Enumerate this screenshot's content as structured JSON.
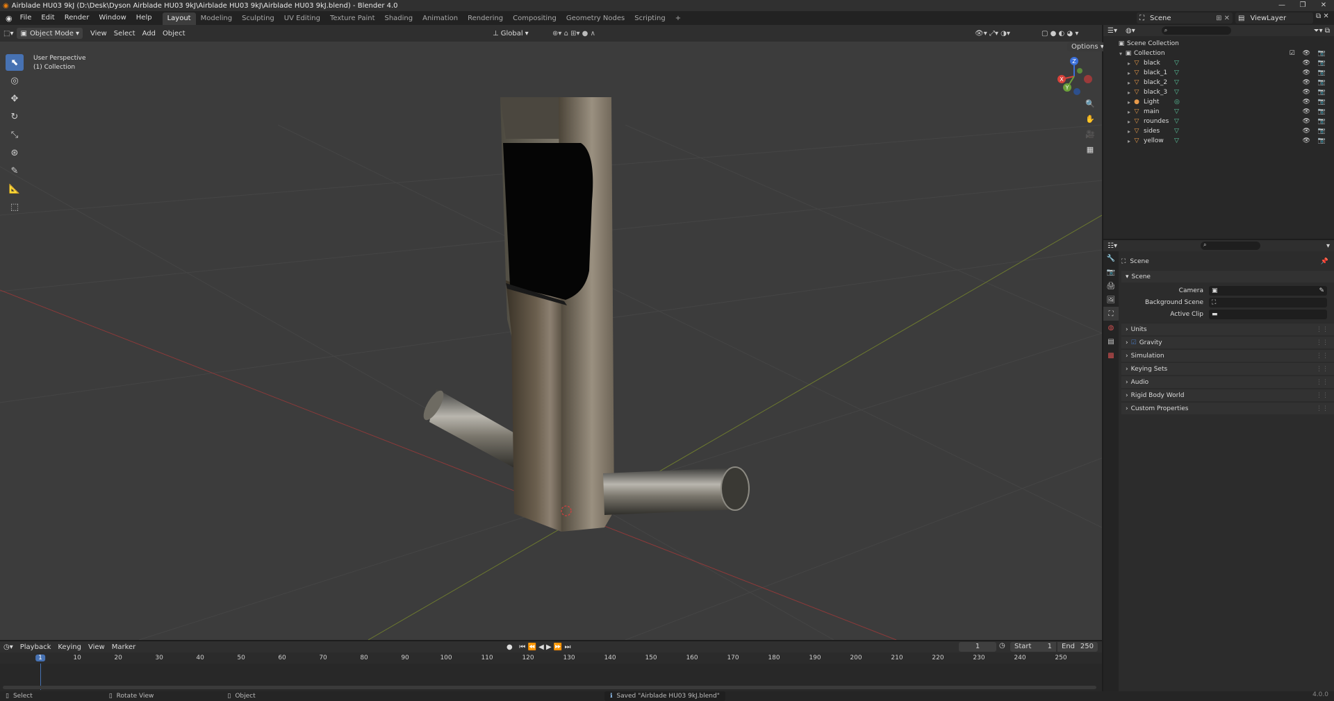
{
  "window": {
    "title": "Airblade HU03 9kJ (D:\\Desk\\Dyson Airblade HU03 9kJ\\Airblade HU03 9kJ\\Airblade HU03 9kJ.blend) - Blender 4.0"
  },
  "menubar": {
    "menus": [
      "File",
      "Edit",
      "Render",
      "Window",
      "Help"
    ],
    "workspaces": [
      "Layout",
      "Modeling",
      "Sculpting",
      "UV Editing",
      "Texture Paint",
      "Shading",
      "Animation",
      "Rendering",
      "Compositing",
      "Geometry Nodes",
      "Scripting",
      "+"
    ],
    "active_workspace": "Layout",
    "scene": "Scene",
    "view_layer": "ViewLayer"
  },
  "viewport_header": {
    "mode": "Object Mode",
    "menus": [
      "View",
      "Select",
      "Add",
      "Object"
    ],
    "orientation": "Global",
    "options": "Options"
  },
  "viewport": {
    "perspective": "User Perspective",
    "collection": "(1) Collection",
    "gizmo": {
      "x": "X",
      "y": "Y",
      "z": "Z"
    }
  },
  "outliner": {
    "root": "Scene Collection",
    "collection": "Collection",
    "items": [
      {
        "name": "black",
        "type": "mesh"
      },
      {
        "name": "black_1",
        "type": "mesh"
      },
      {
        "name": "black_2",
        "type": "mesh"
      },
      {
        "name": "black_3",
        "type": "mesh"
      },
      {
        "name": "Light",
        "type": "light"
      },
      {
        "name": "main",
        "type": "mesh"
      },
      {
        "name": "roundes",
        "type": "mesh"
      },
      {
        "name": "sides",
        "type": "mesh"
      },
      {
        "name": "yellow",
        "type": "mesh"
      }
    ]
  },
  "properties": {
    "context": "Scene",
    "section": "Scene",
    "fields": {
      "camera": "Camera",
      "background_scene": "Background Scene",
      "active_clip": "Active Clip"
    },
    "panels": [
      "Units",
      "Gravity",
      "Simulation",
      "Keying Sets",
      "Audio",
      "Rigid Body World",
      "Custom Properties"
    ],
    "gravity_checked": true
  },
  "timeline": {
    "menus": [
      "Playback",
      "Keying",
      "View",
      "Marker"
    ],
    "current_frame": "1",
    "start_label": "Start",
    "start": "1",
    "end_label": "End",
    "end": "250",
    "ticks": [
      "1",
      "10",
      "20",
      "30",
      "40",
      "50",
      "60",
      "70",
      "80",
      "90",
      "100",
      "110",
      "120",
      "130",
      "140",
      "150",
      "160",
      "170",
      "180",
      "190",
      "200",
      "210",
      "220",
      "230",
      "240",
      "250"
    ]
  },
  "statusbar": {
    "select": "Select",
    "rotate": "Rotate View",
    "object": "Object",
    "message": "Saved \"Airblade HU03 9kJ.blend\"",
    "version": "4.0.0"
  },
  "colors": {
    "accent": "#4772b3",
    "background": "#3c3c3c"
  }
}
